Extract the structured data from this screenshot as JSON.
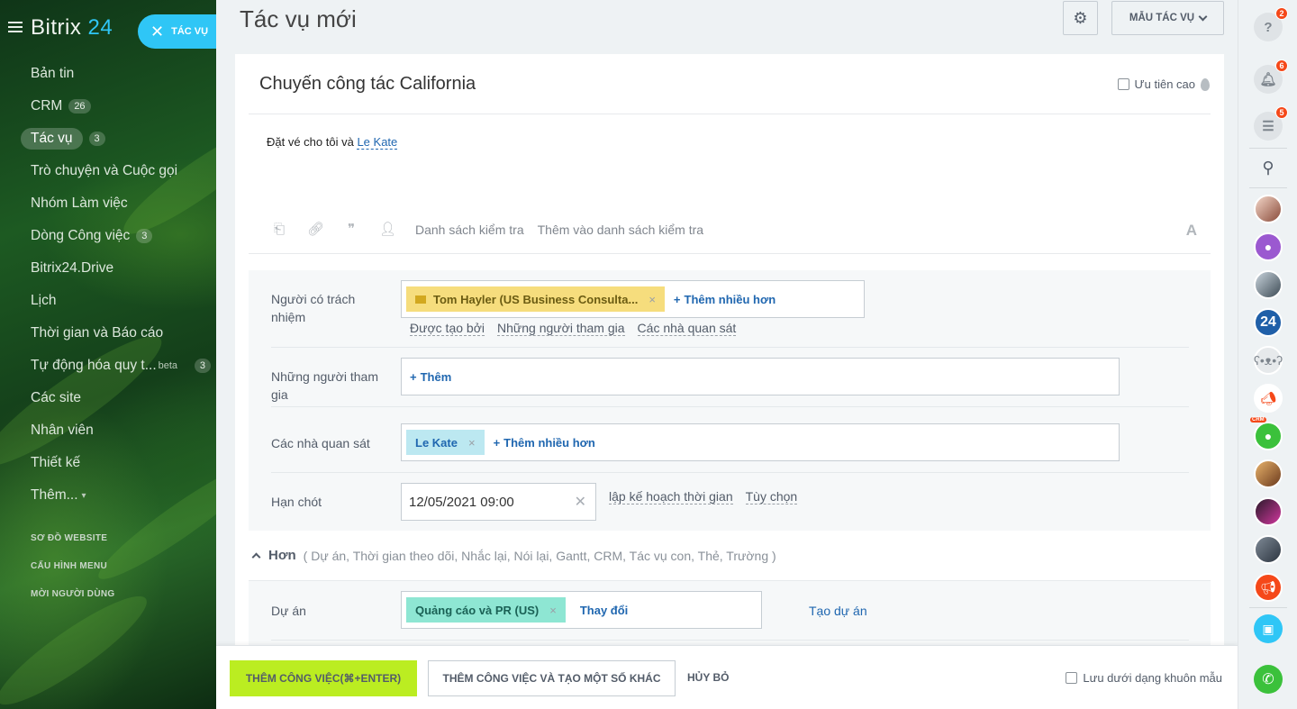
{
  "sidebar": {
    "logo_text": "Bitrix",
    "logo_num": "24",
    "task_pill_label": "TÁC VỤ",
    "items": [
      {
        "label": "Bản tin",
        "counter": ""
      },
      {
        "label": "CRM",
        "counter": "26"
      },
      {
        "label": "Tác vụ",
        "counter": "3"
      },
      {
        "label": "Trò chuyện và Cuộc gọi",
        "counter": ""
      },
      {
        "label": "Nhóm Làm việc",
        "counter": ""
      },
      {
        "label": "Dòng Công việc",
        "counter": "3"
      },
      {
        "label": "Bitrix24.Drive",
        "counter": ""
      },
      {
        "label": "Lịch",
        "counter": ""
      },
      {
        "label": "Thời gian và Báo cáo",
        "counter": ""
      },
      {
        "label": "Tự động hóa quy t...",
        "beta": "beta",
        "counter": "3"
      },
      {
        "label": "Các site",
        "counter": ""
      },
      {
        "label": "Nhân viên",
        "counter": ""
      },
      {
        "label": "Thiết kế",
        "counter": ""
      },
      {
        "label": "Thêm...",
        "counter": ""
      }
    ],
    "small_links": [
      "SƠ ĐỒ WEBSITE",
      "CẤU HÌNH MENU",
      "MỜI NGƯỜI DÙNG"
    ]
  },
  "header": {
    "title": "Tác vụ mới",
    "template_button": "MẪU TÁC VỤ"
  },
  "task": {
    "title": "Chuyến công tác California",
    "priority_label": "Ưu tiên cao",
    "description_text": "Đặt vé cho tôi và ",
    "description_link": "Le Kate",
    "toolbar_links": [
      "Danh sách kiểm tra",
      "Thêm vào danh sách kiểm tra"
    ],
    "toolbar_font_icon": "A"
  },
  "fields": {
    "responsible": {
      "label": "Người có trách nhiệm",
      "chip": "Tom Hayler (US Business Consulta...",
      "add_more": "Thêm nhiều hơn",
      "sub_links": [
        "Được tạo bởi",
        "Những người tham gia",
        "Các nhà quan sát"
      ]
    },
    "participants": {
      "label": "Những người tham gia",
      "add": "Thêm"
    },
    "observers": {
      "label": "Các nhà quan sát",
      "chip": "Le Kate",
      "add_more": "Thêm nhiều hơn"
    },
    "deadline": {
      "label": "Hạn chót",
      "value": "12/05/2021 09:00",
      "links": [
        "lập kế hoạch thời gian",
        "Tùy chọn"
      ]
    }
  },
  "more": {
    "label": "Hơn",
    "items": "( Dự án,  Thời gian theo dõi,  Nhắc lại,  Nói lại,  Gantt,  CRM,  Tác vụ con,  Thẻ,  Trường )"
  },
  "project": {
    "label": "Dự án",
    "chip": "Quảng cáo và PR (US)",
    "change": "Thay đổi",
    "create": "Tạo dự án"
  },
  "footer": {
    "primary": "THÊM CÔNG VIỆC(⌘+ENTER)",
    "secondary": "THÊM CÔNG VIỆC VÀ TẠO MỘT SỐ KHÁC",
    "cancel": "HỦY BỎ",
    "save_template": "Lưu dưới dạng khuôn mẫu"
  },
  "rightbar": {
    "help_badge": "2",
    "notify_badge": "6",
    "chat_badge": "5",
    "avatar_24": "24",
    "crm_tag": "CRM"
  },
  "colors": {
    "accent": "#2fc6f6",
    "primary_button": "#bbed21",
    "link": "#2067b0",
    "badge": "#f54819"
  }
}
